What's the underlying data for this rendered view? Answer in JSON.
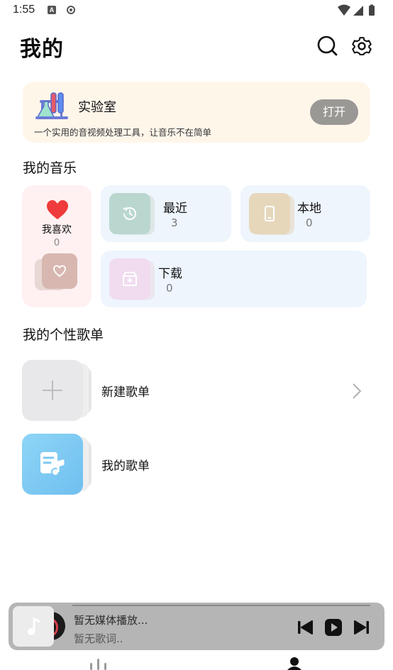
{
  "status_bar": {
    "time": "1:55",
    "badge": "A"
  },
  "header": {
    "title": "我的",
    "search_icon": "search-icon",
    "settings_icon": "gear-icon"
  },
  "lab": {
    "title": "实验室",
    "description": "一个实用的音视频处理工具，让音乐不在简单",
    "open_label": "打开",
    "icon": "flask-icon"
  },
  "my_music": {
    "title": "我的音乐",
    "favorites": {
      "label": "我喜欢",
      "count": "0",
      "icon": "heart-icon"
    },
    "recent": {
      "label": "最近",
      "count": "3",
      "icon": "history-icon",
      "color": "#b9d7cf"
    },
    "local": {
      "label": "本地",
      "count": "0",
      "icon": "phone-icon",
      "color": "#e6d7bb"
    },
    "download": {
      "label": "下载",
      "count": "0",
      "icon": "download-box-icon",
      "color": "#f1dcef"
    }
  },
  "playlists": {
    "title": "我的个性歌单",
    "items": [
      {
        "label": "新建歌单",
        "icon": "plus-icon"
      },
      {
        "label": "我的歌单",
        "icon": "music-note-doc-icon"
      }
    ]
  },
  "mini_player": {
    "title": "暂无媒体播放...",
    "lyric": "暂无歌词..",
    "icons": [
      "previous-icon",
      "play-icon",
      "next-icon"
    ]
  },
  "colors": {
    "accent_red": "#ef4444",
    "lab_bg": "#fff6ea",
    "tile_bg": "#eef5fd",
    "fav_bg": "#fff0f2",
    "playlist_blue": "#7fcaf3"
  }
}
